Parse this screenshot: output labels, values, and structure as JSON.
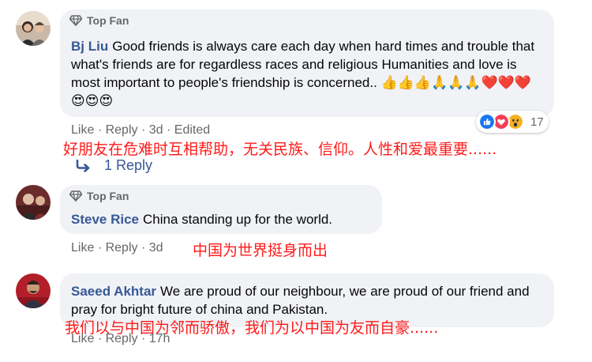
{
  "comments": [
    {
      "badge": "Top Fan",
      "author": "Bj Liu",
      "text": "Good friends is always care each day when hard times and trouble that what's friends are for regardless races and religious Humanities and love is most important to people's friendship is concerned.. 👍👍👍🙏🙏🙏❤️❤️❤️😍😍😍",
      "actions": {
        "like": "Like",
        "reply": "Reply",
        "time": "3d",
        "edited": "Edited"
      },
      "reactions_count": "17",
      "translation": "好朋友在危难时互相帮助，无关民族、信仰。人性和爱最重要......",
      "reply_count_label": "1 Reply"
    },
    {
      "badge": "Top Fan",
      "author": "Steve Rice",
      "text": "China standing up for the world.",
      "actions": {
        "like": "Like",
        "reply": "Reply",
        "time": "3d"
      },
      "translation": "中国为世界挺身而出"
    },
    {
      "author": "Saeed Akhtar",
      "text": "We are proud of our neighbour, we are proud of our friend and pray for bright future of china and Pakistan.",
      "actions": {
        "like": "Like",
        "reply": "Reply",
        "time": "17h"
      },
      "translation": "我们以与中国为邻而骄傲，我们为以中国为友而自豪......"
    }
  ],
  "colors": {
    "author": "#385898",
    "meta": "#65676b",
    "bubble": "#f0f2f5",
    "translation": "#ff1a1a"
  },
  "icons": [
    "diamond-icon",
    "reply-arrow-icon",
    "like-reaction-icon",
    "love-reaction-icon",
    "wow-reaction-icon"
  ]
}
